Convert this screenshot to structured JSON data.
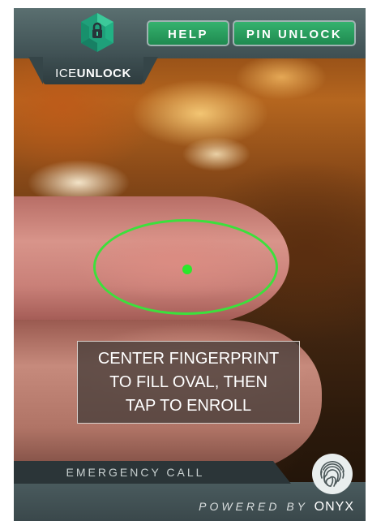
{
  "header": {
    "brand": {
      "prefix": "ICE",
      "suffix": "UNLOCK"
    },
    "help_label": "HELP",
    "pin_unlock_label": "PIN UNLOCK"
  },
  "scan": {
    "instruction": "CENTER FINGERPRINT\nTO FILL OVAL, THEN\nTAP TO ENROLL"
  },
  "footer": {
    "emergency_label": "EMERGENCY CALL",
    "powered_by": "POWERED BY",
    "powered_brand": "ONYX"
  },
  "icons": {
    "logo": "ice-unlock-logo-icon",
    "fingerprint": "fingerprint-icon"
  },
  "colors": {
    "accent_green": "#2fa865",
    "oval_green": "#3ce03c",
    "bar_gray": "#4a5b5e"
  }
}
